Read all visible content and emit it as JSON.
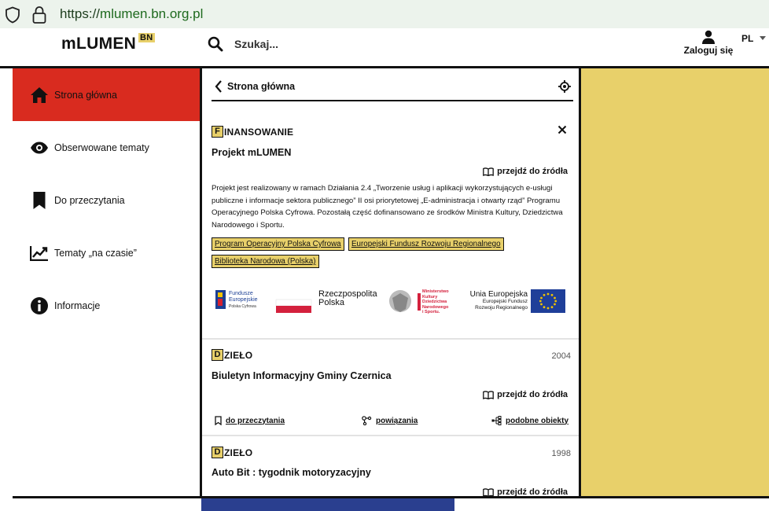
{
  "browser": {
    "url_scheme": "https://",
    "url_host": "mlumen.bn.org.pl"
  },
  "header": {
    "logo": "mLUMEN",
    "logo_badge": "BN",
    "search_placeholder": "Szukaj...",
    "login_label": "Zaloguj się",
    "language": "PL"
  },
  "sidebar": {
    "items": [
      {
        "label": "Strona główna",
        "icon": "home-icon",
        "active": true
      },
      {
        "label": "Obserwowane tematy",
        "icon": "eye-icon",
        "active": false
      },
      {
        "label": "Do przeczytania",
        "icon": "bookmark-icon",
        "active": false
      },
      {
        "label": "Tematy „na czasie”",
        "icon": "trending-icon",
        "active": false
      },
      {
        "label": "Informacje",
        "icon": "info-icon",
        "active": false
      }
    ]
  },
  "main": {
    "breadcrumb": "Strona główna",
    "funding_card": {
      "type_letter": "F",
      "type_rest": "INANSOWANIE",
      "title": "Projekt mLUMEN",
      "source_link": "przejdź do źródła",
      "description": "Projekt jest realizowany w ramach Działania 2.4 „Tworzenie usług i aplikacji wykorzystujących e-usługi publiczne i informacje sektora publicznego” II osi priorytetowej „E-administracja i otwarty rząd” Programu Operacyjnego Polska Cyfrowa. Pozostałą część dofinansowano ze środków Ministra Kultury, Dziedzictwa Narodowego i Sportu.",
      "tags": [
        "Program Operacyjny Polska Cyfrowa",
        "Europejski Fundusz Rozwoju Regionalnego",
        "Biblioteka Narodowa (Polska)"
      ],
      "logos": {
        "fe_line1": "Fundusze",
        "fe_line2": "Europejskie",
        "fe_line3": "Polska Cyfrowa",
        "rp_line1": "Rzeczpospolita",
        "rp_line2": "Polska",
        "mk_line1": "Ministerstwo",
        "mk_line2": "Kultury",
        "mk_line3": "Dziedzictwa",
        "mk_line4": "Narodowego",
        "mk_line5": "i Sportu.",
        "ue_line1": "Unia Europejska",
        "ue_line2": "Europejski Fundusz",
        "ue_line3": "Rozwoju Regionalnego"
      }
    },
    "work_cards": [
      {
        "type_letter": "D",
        "type_rest": "ZIEŁO",
        "year": "2004",
        "title": "Biuletyn Informacyjny Gminy Czernica",
        "source_link": "przejdź do źródła",
        "actions": {
          "read": "do przeczytania",
          "relations": "powiązania",
          "similar": "podobne obiekty"
        }
      },
      {
        "type_letter": "D",
        "type_rest": "ZIEŁO",
        "year": "1998",
        "title": "Auto Bit : tygodnik motoryzacyjny",
        "source_link": "przejdź do źródła"
      }
    ]
  },
  "colors": {
    "accent_red": "#d92b1f",
    "accent_yellow": "#e8d06a",
    "blue": "#2a3f8f"
  }
}
